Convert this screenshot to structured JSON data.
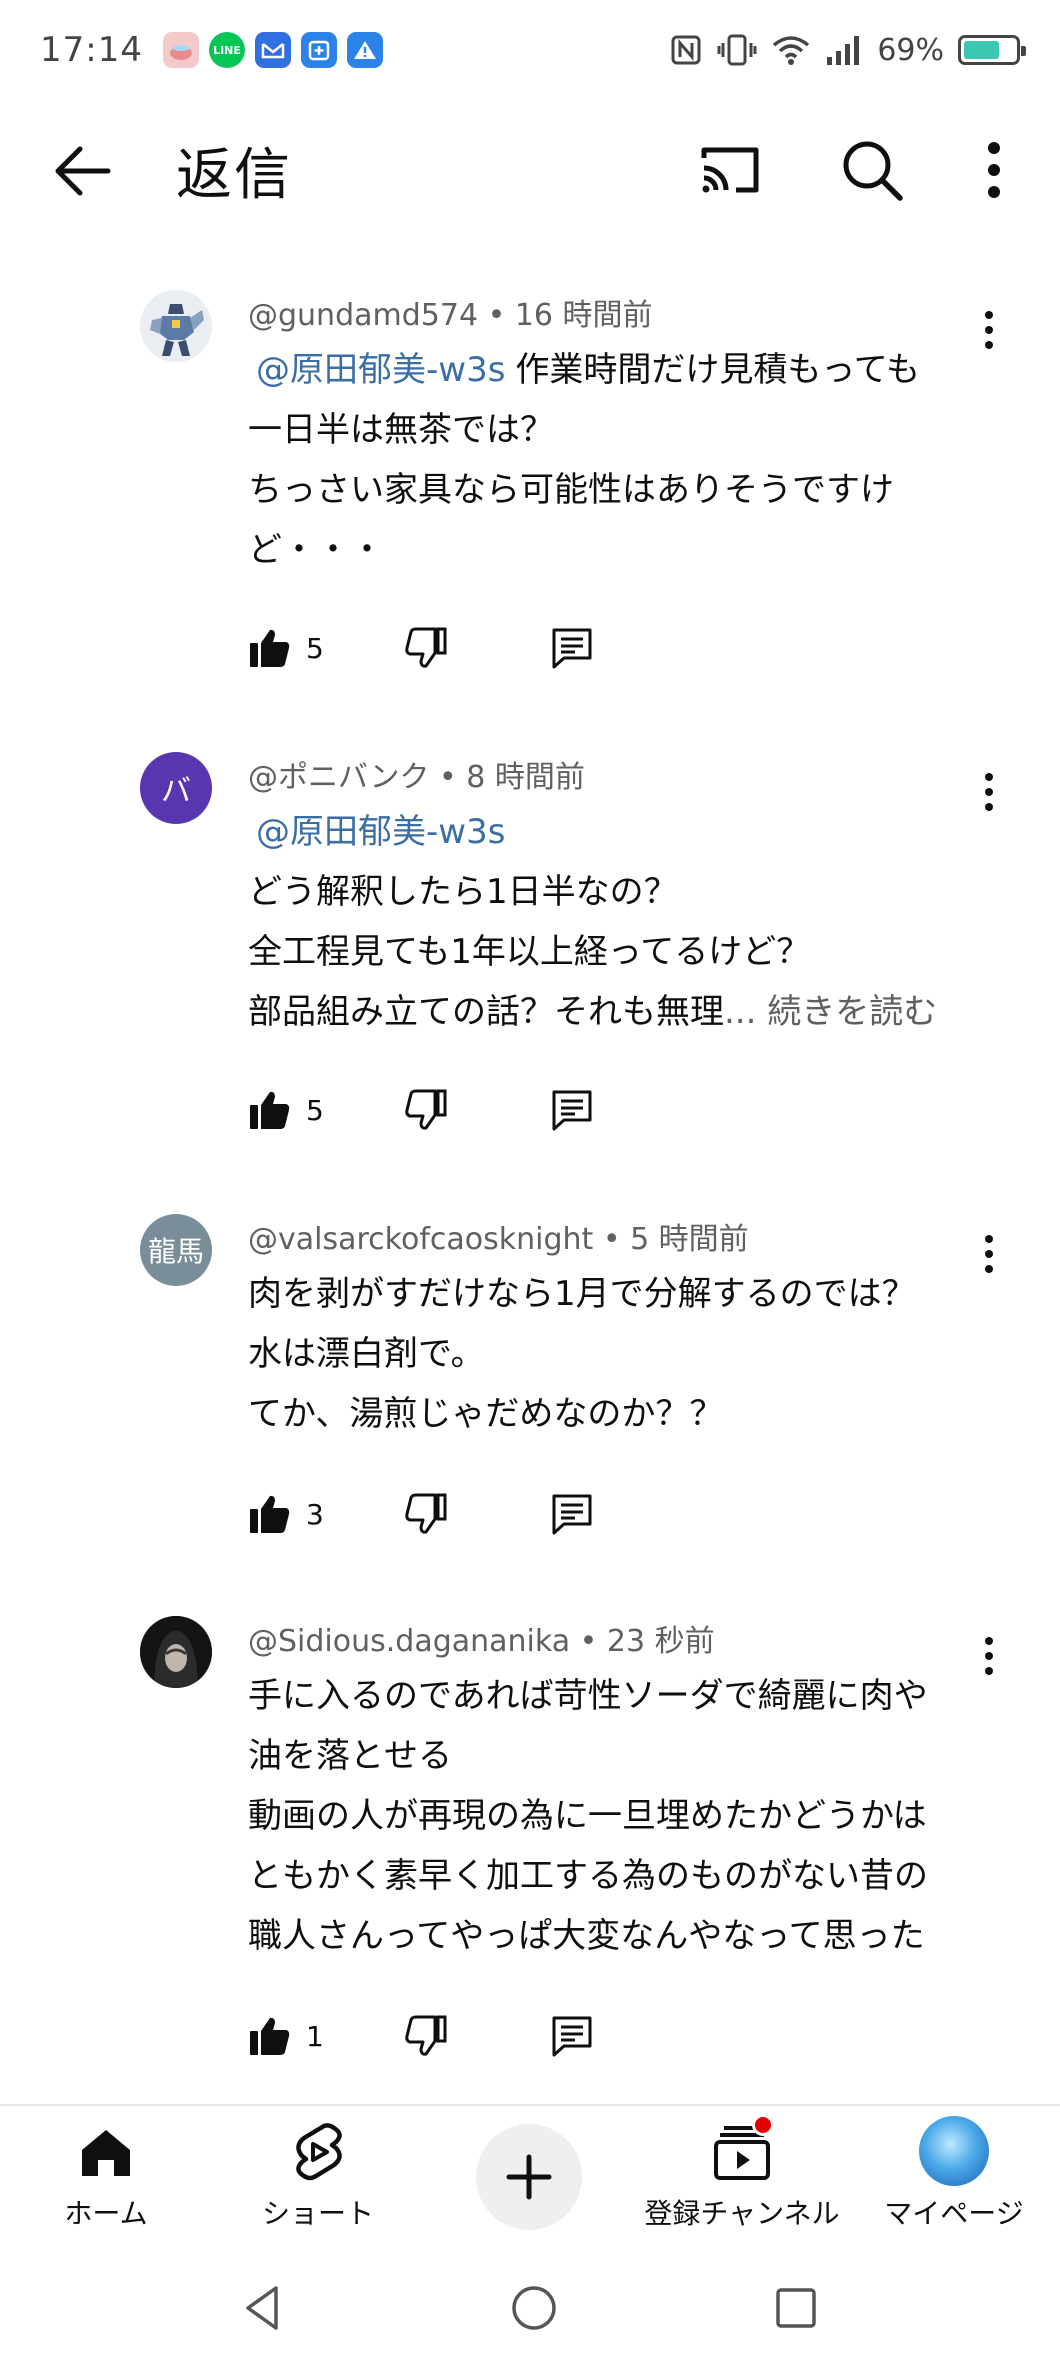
{
  "status_bar": {
    "time": "17:14",
    "battery": "69%",
    "battery_level": 0.69,
    "notification_icons": [
      "tea-cup-icon",
      "line-icon",
      "mail-icon",
      "calendar-plus-icon",
      "warning-icon"
    ]
  },
  "app_bar": {
    "title": "返信"
  },
  "comments": [
    {
      "author": "@gundamd574",
      "time": "16 時間前",
      "avatar_color": "#dfe6ee",
      "mention": "@原田郁美-w3s",
      "lines": [
        "作業時間だけ見積もっても",
        "一日半は無茶では？",
        "ちっさい家具なら可能性はありそうですけ",
        "ど・・・"
      ],
      "likes": "5"
    },
    {
      "author": "@ポニバンク",
      "time": "8 時間前",
      "avatar_text": "バ",
      "avatar_color": "#5a35b0",
      "mention": "@原田郁美-w3s",
      "lines": [
        "どう解釈したら1日半なの？",
        "全工程見ても1年以上経ってるけど？",
        "部品組み立ての話？それも無理"
      ],
      "read_more": "... 続きを読む",
      "likes": "5"
    },
    {
      "author": "@valsarckofcaosknight",
      "time": "5 時間前",
      "avatar_text": "龍馬",
      "avatar_color": "#7a8e99",
      "lines": [
        "肉を剥がすだけなら1月で分解するのでは？",
        "水は漂白剤で。",
        "てか、湯煎じゃだめなのか？？"
      ],
      "likes": "3"
    },
    {
      "author": "@Sidious.dagananika",
      "time": "23 秒前",
      "avatar_color": "#1a1a1a",
      "lines": [
        "手に入るのであれば苛性ソーダで綺麗に肉や",
        "油を落とせる",
        "動画の人が再現の為に一旦埋めたかどうかは",
        "ともかく素早く加工する為のものがない昔の",
        "職人さんってやっぱ大変なんやなって思った"
      ],
      "likes": "1"
    }
  ],
  "bottom_nav": {
    "home": "ホーム",
    "shorts": "ショート",
    "subscriptions": "登録チャンネル",
    "you": "マイページ"
  }
}
